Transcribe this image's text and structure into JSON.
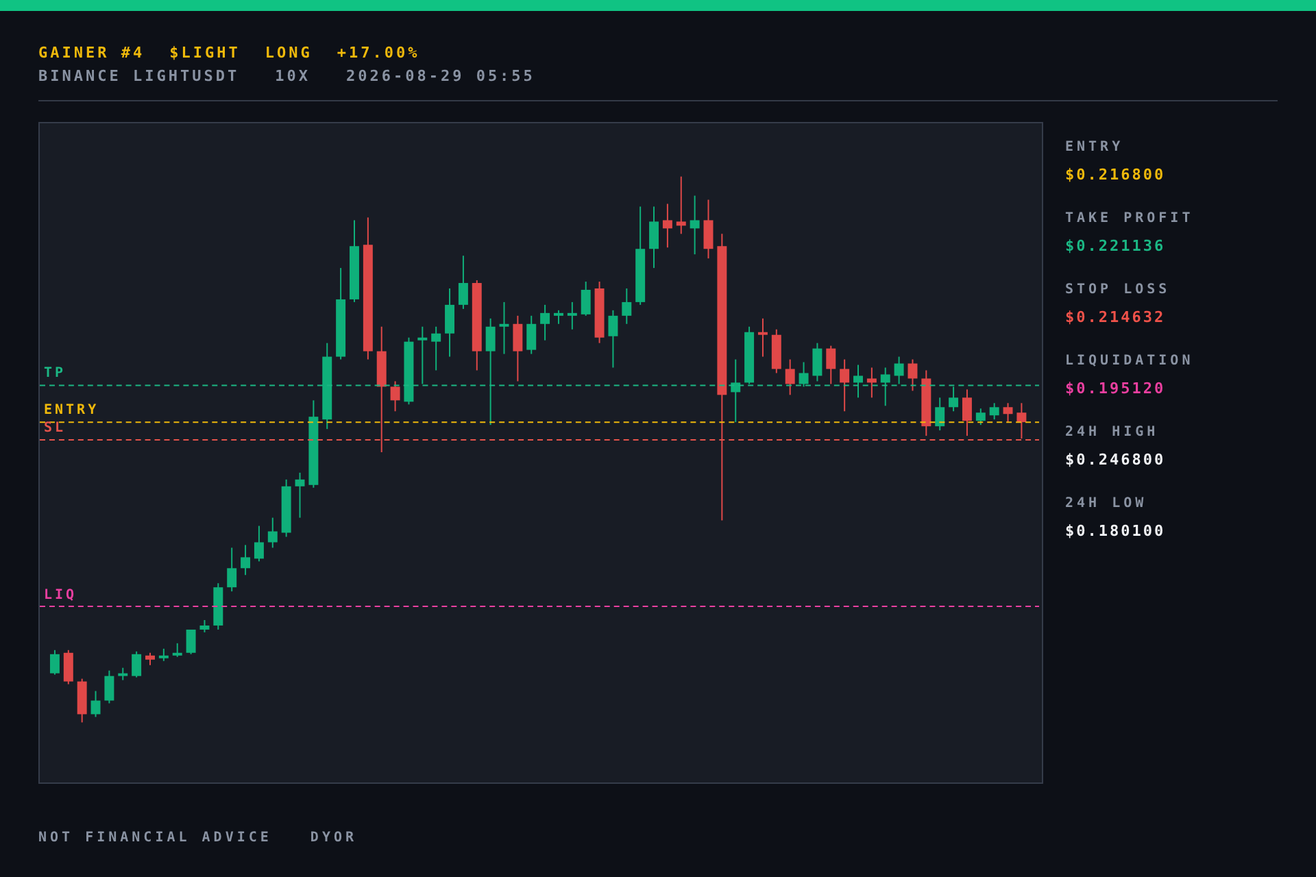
{
  "header": {
    "title": [
      {
        "text": "GAINER #4"
      },
      {
        "text": "$LIGHT"
      },
      {
        "text": "LONG"
      },
      {
        "text": "+17.00%"
      }
    ],
    "subtitle": [
      {
        "text": "BINANCE LIGHTUSDT"
      },
      {
        "text": "10X"
      },
      {
        "text": "2026-08-29 05:55"
      }
    ]
  },
  "chart": {
    "levels": [
      {
        "kind": "tp",
        "label": "TP",
        "color": "#1bb784"
      },
      {
        "kind": "entry",
        "label": "ENTRY",
        "color": "#f0b90b"
      },
      {
        "kind": "sl",
        "label": "SL",
        "color": "#e5534b"
      },
      {
        "kind": "liq",
        "label": "LIQ",
        "color": "#ea3fa0"
      }
    ]
  },
  "stats": [
    {
      "label": "ENTRY",
      "value": "$0.216800",
      "color": "#f0b90b"
    },
    {
      "label": "TAKE PROFIT",
      "value": "$0.221136",
      "color": "#1bb784"
    },
    {
      "label": "STOP LOSS",
      "value": "$0.214632",
      "color": "#f0524a"
    },
    {
      "label": "LIQUIDATION",
      "value": "$0.195120",
      "color": "#ea3fa0"
    },
    {
      "label": "24H HIGH",
      "value": "$0.246800",
      "color": "#f2f4f7"
    },
    {
      "label": "24H LOW",
      "value": "$0.180100",
      "color": "#f2f4f7"
    }
  ],
  "footer": [
    {
      "text": "NOT FINANCIAL ADVICE"
    },
    {
      "text": "DYOR"
    }
  ]
}
